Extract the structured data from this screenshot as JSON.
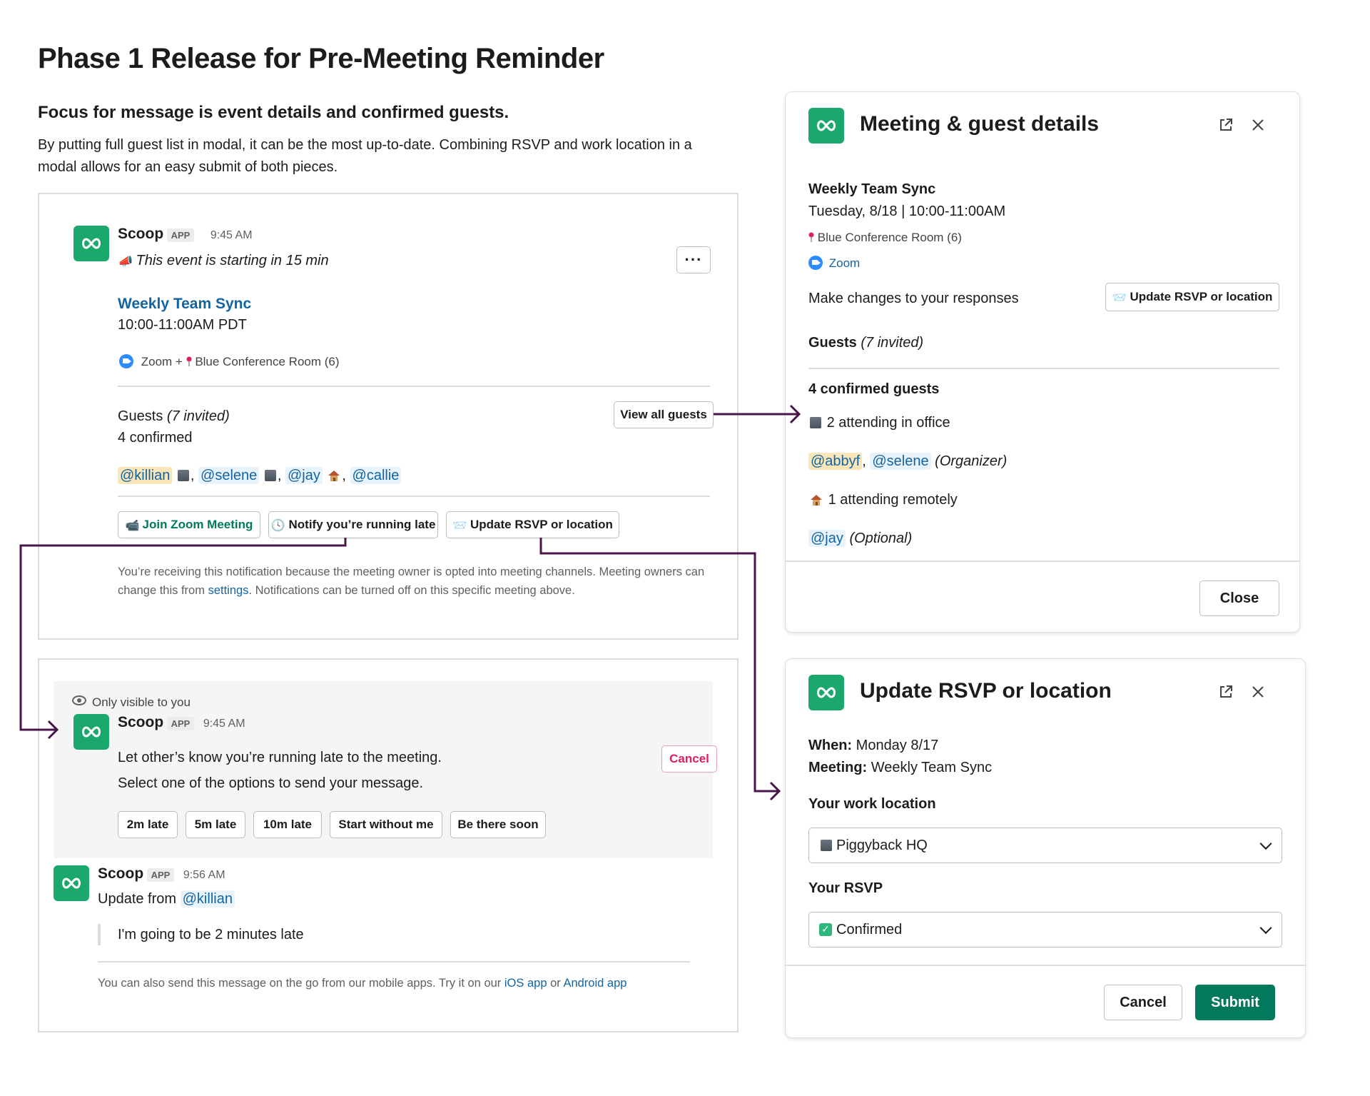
{
  "page": {
    "title": "Phase 1 Release for Pre-Meeting Reminder",
    "subtitle": "Focus for message is event details and confirmed guests.",
    "description": "By putting full guest list in modal, it can be the most up-to-date. Combining RSVP and work location in a modal allows for an easy submit of both pieces."
  },
  "message1": {
    "sender": "Scoop",
    "badge": "APP",
    "time": "9:45 AM",
    "headline": "This event is starting in 15 min",
    "event_title": "Weekly Team Sync",
    "event_time": "10:00-11:00AM PDT",
    "zoom_label": "Zoom +",
    "room": "Blue Conference Room (6)",
    "guests_label": "Guests",
    "guests_invited": "(7 invited)",
    "confirmed": "4 confirmed",
    "view_all_button": "View all guests",
    "mentions": [
      "@killian",
      "@selene",
      "@jay",
      "@callie"
    ],
    "buttons": {
      "join_zoom": "Join Zoom Meeting",
      "notify_late": "Notify you’re running late",
      "update_rsvp": "Update RSVP or location"
    },
    "footer_pre": "You’re receiving this notification because the meeting owner is opted into meeting channels. Meeting owners can change this from ",
    "footer_link": "settings",
    "footer_post": ". Notifications can be turned off on this specific meeting above.",
    "more_icon": "ellipsis-icon"
  },
  "message2": {
    "visibility": "Only visible to you",
    "sender": "Scoop",
    "badge": "APP",
    "time": "9:45 AM",
    "line1": "Let other’s know you’re running late to the meeting.",
    "line2": "Select one of the options to send your message.",
    "cancel_button": "Cancel",
    "options": [
      "2m late",
      "5m late",
      "10m late",
      "Start without me",
      "Be there soon"
    ]
  },
  "message3": {
    "sender": "Scoop",
    "badge": "APP",
    "time": "9:56 AM",
    "update_from": "Update from",
    "mention": "@killian",
    "quote": "I'm going to be 2 minutes late",
    "footer_pre": "You can also send this message on the go from our mobile apps. Try it on our ",
    "ios_link": "iOS app",
    "or": " or ",
    "android_link": "Android app"
  },
  "modal_details": {
    "title": "Meeting & guest details",
    "event_title": "Weekly Team Sync",
    "event_datetime": "Tuesday, 8/18 | 10:00-11:00AM",
    "room": "Blue Conference Room (6)",
    "zoom": "Zoom",
    "changes_label": "Make changes to your responses",
    "update_button": "Update RSVP or location",
    "guests_label": "Guests",
    "guests_invited": "(7 invited)",
    "confirmed_heading": "4 confirmed guests",
    "office_line": "2 attending in office",
    "office_mentions": [
      "@abbyf",
      "@selene"
    ],
    "organizer": "(Organizer)",
    "remote_line": "1 attending remotely",
    "remote_mention": "@jay",
    "optional": "(Optional)",
    "close_button": "Close"
  },
  "modal_rsvp": {
    "title": "Update RSVP or location",
    "when_label": "When:",
    "when_value": "Monday 8/17",
    "meeting_label": "Meeting:",
    "meeting_value": "Weekly Team Sync",
    "work_location_label": "Your work location",
    "work_location_value": "Piggyback HQ",
    "rsvp_label": "Your RSVP",
    "rsvp_value": "Confirmed",
    "cancel_button": "Cancel",
    "submit_button": "Submit"
  },
  "colors": {
    "brand_green": "#1aa86c",
    "submit_green": "#007a5a",
    "link_blue": "#1264a3",
    "arrow_purple": "#4a154b",
    "cancel_red": "#e01e5a"
  }
}
